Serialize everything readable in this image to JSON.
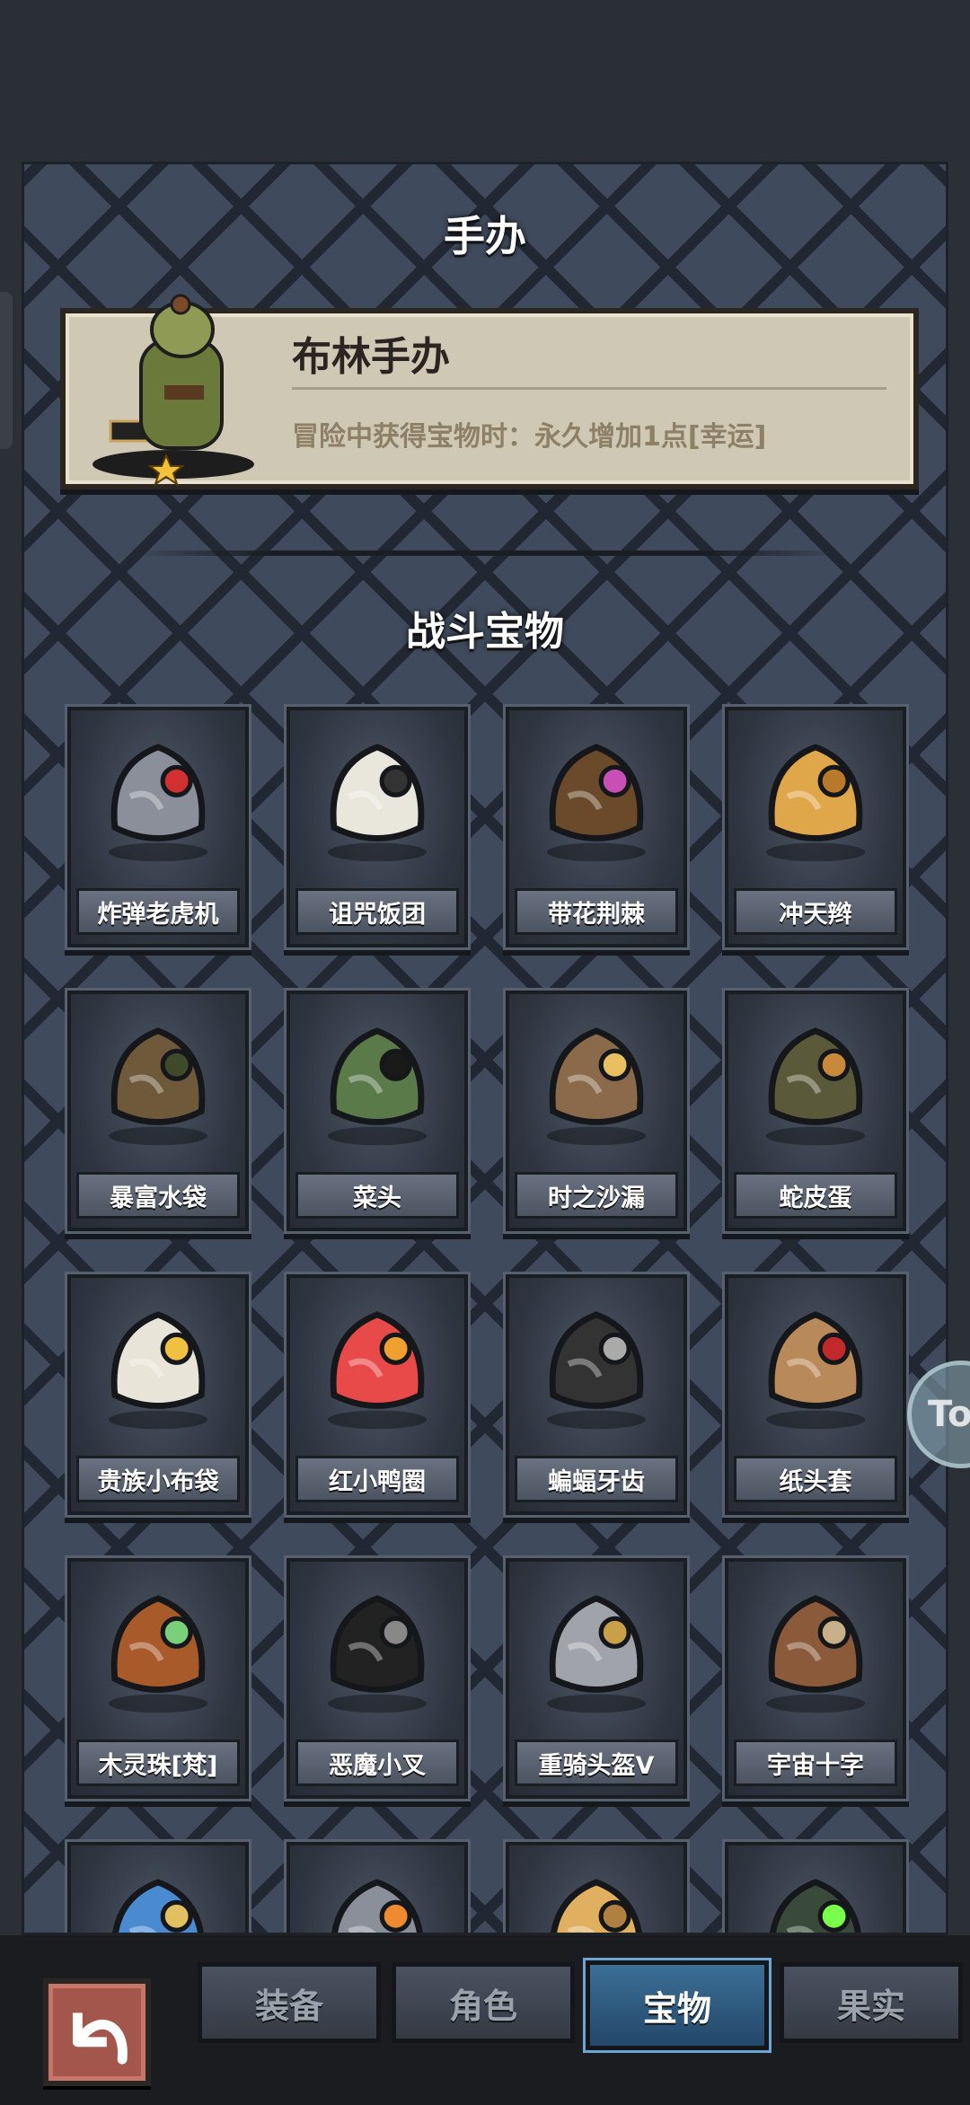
{
  "header": {
    "title": "手办"
  },
  "figure": {
    "name": "布林手办",
    "description": "冒险中获得宝物时：永久增加1点[幸运]",
    "star_icon": "star-icon"
  },
  "section": {
    "title": "战斗宝物"
  },
  "treasures": [
    {
      "label": "炸弹老虎机",
      "icon": "slot-machine-icon"
    },
    {
      "label": "诅咒饭团",
      "icon": "rice-ball-icon"
    },
    {
      "label": "带花荆棘",
      "icon": "thorn-flower-icon"
    },
    {
      "label": "冲天辫",
      "icon": "ponytail-icon"
    },
    {
      "label": "暴富水袋",
      "icon": "water-flask-icon"
    },
    {
      "label": "菜头",
      "icon": "spiky-head-icon"
    },
    {
      "label": "时之沙漏",
      "icon": "hourglass-icon"
    },
    {
      "label": "蛇皮蛋",
      "icon": "snake-egg-icon"
    },
    {
      "label": "贵族小布袋",
      "icon": "cloth-bag-icon"
    },
    {
      "label": "红小鸭圈",
      "icon": "duck-ring-icon"
    },
    {
      "label": "蝙蝠牙齿",
      "icon": "bat-teeth-icon"
    },
    {
      "label": "纸头套",
      "icon": "paper-bag-mask-icon"
    },
    {
      "label": "木灵珠[梵]",
      "icon": "wood-orb-icon"
    },
    {
      "label": "恶魔小叉",
      "icon": "trident-icon"
    },
    {
      "label": "重骑头盔V",
      "icon": "knight-helmet-icon"
    },
    {
      "label": "宇宙十字",
      "icon": "wooden-cross-icon"
    },
    {
      "label": "",
      "icon": "blue-feather-icon"
    },
    {
      "label": "",
      "icon": "mech-core-icon"
    },
    {
      "label": "",
      "icon": "scroll-icon"
    },
    {
      "label": "",
      "icon": "green-stone-icon"
    }
  ],
  "bottom_nav": {
    "back_icon": "back-arrow-icon",
    "tabs": [
      {
        "label": "装备",
        "active": false
      },
      {
        "label": "角色",
        "active": false
      },
      {
        "label": "宝物",
        "active": true
      },
      {
        "label": "果实",
        "active": false
      }
    ]
  },
  "floating": {
    "label": "To"
  },
  "colors": {
    "panel": "#3f4a5c",
    "active_tab": "#2e5b80",
    "card": "#cfc8b4"
  }
}
